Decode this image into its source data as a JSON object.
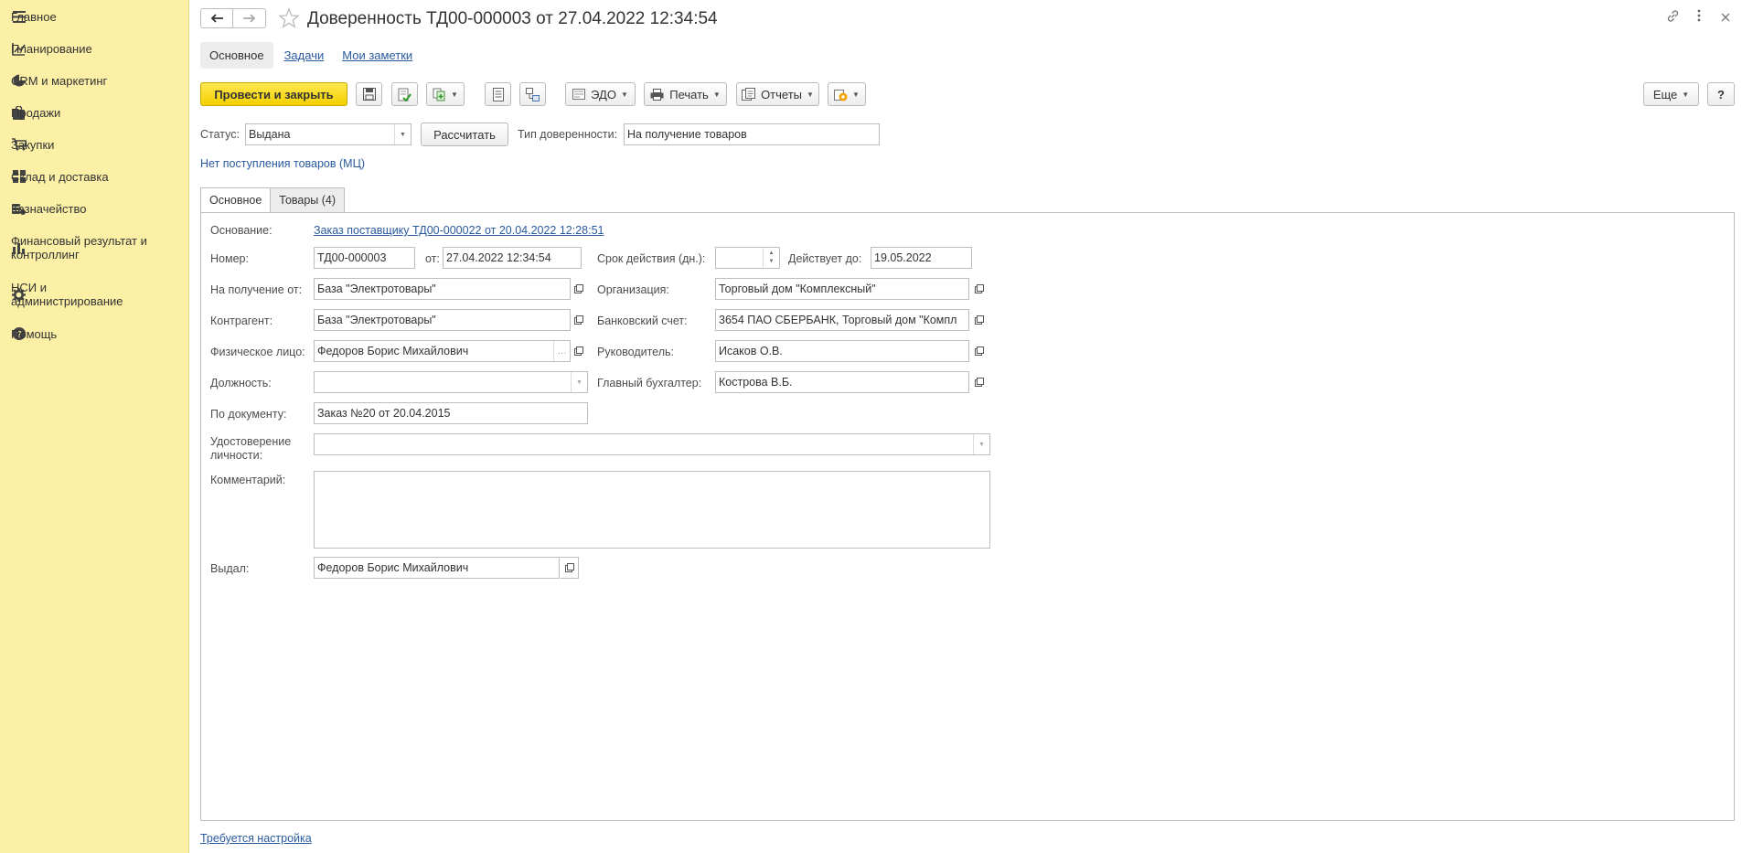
{
  "sidebar": {
    "items": [
      {
        "label": "Главное",
        "icon": "menu-icon"
      },
      {
        "label": "Планирование",
        "icon": "planning-icon"
      },
      {
        "label": "CRM и маркетинг",
        "icon": "pie-chart-icon"
      },
      {
        "label": "Продажи",
        "icon": "shopping-bag-icon"
      },
      {
        "label": "Закупки",
        "icon": "cart-icon"
      },
      {
        "label": "Склад и доставка",
        "icon": "warehouse-grid-icon"
      },
      {
        "label": "Казначейство",
        "icon": "coins-icon"
      },
      {
        "label": "Финансовый результат и контроллинг",
        "icon": "bar-chart-icon"
      },
      {
        "label": "НСИ и администрирование",
        "icon": "gear-icon"
      },
      {
        "label": "Помощь",
        "icon": "help-icon"
      }
    ]
  },
  "header": {
    "title": "Доверенность ТД00-000003 от 27.04.2022 12:34:54"
  },
  "top_tabs": {
    "active": "Основное",
    "links": [
      "Задачи",
      "Мои заметки"
    ]
  },
  "toolbar": {
    "post_close": "Провести и закрыть",
    "edo": "ЭДО",
    "print": "Печать",
    "reports": "Отчеты",
    "more": "Еще",
    "help": "?"
  },
  "status_row": {
    "status_label": "Статус:",
    "status_value": "Выдана",
    "calc_button": "Рассчитать",
    "type_label": "Тип доверенности:",
    "type_value": "На получение товаров"
  },
  "notice_link": "Нет поступления товаров (МЦ)",
  "form_tabs": [
    "Основное",
    "Товары (4)"
  ],
  "form": {
    "basis_label": "Основание:",
    "basis_value": "Заказ поставщику ТД00-000022 от 20.04.2022 12:28:51",
    "number_label": "Номер:",
    "number_value": "ТД00-000003",
    "from_label": "от:",
    "from_value": "27.04.2022 12:34:54",
    "validity_label": "Срок действия (дн.):",
    "validity_value": "",
    "valid_until_label": "Действует до:",
    "valid_until_value": "19.05.2022",
    "receive_from_label": "На получение от:",
    "receive_from_value": "База \"Электротовары\"",
    "org_label": "Организация:",
    "org_value": "Торговый дом \"Комплексный\"",
    "counterparty_label": "Контрагент:",
    "counterparty_value": "База \"Электротовары\"",
    "bank_label": "Банковский счет:",
    "bank_value": "3654 ПАО СБЕРБАНК, Торговый дом \"Компл",
    "person_label": "Физическое лицо:",
    "person_value": "Федоров Борис Михайлович",
    "head_label": "Руководитель:",
    "head_value": "Исаков О.В.",
    "position_label": "Должность:",
    "position_value": "",
    "accountant_label": "Главный бухгалтер:",
    "accountant_value": "Кострова В.Б.",
    "by_doc_label": "По документу:",
    "by_doc_value": "Заказ №20 от 20.04.2015",
    "id_label": "Удостоверение личности:",
    "id_value": "",
    "comment_label": "Комментарий:",
    "comment_value": "",
    "issued_label": "Выдал:",
    "issued_value": "Федоров Борис Михайлович"
  },
  "footer_link": "Требуется настройка",
  "colors": {
    "sidebar_bg": "#fbf0a6",
    "primary_button": "#f5d20c",
    "link": "#2a5a9e"
  }
}
